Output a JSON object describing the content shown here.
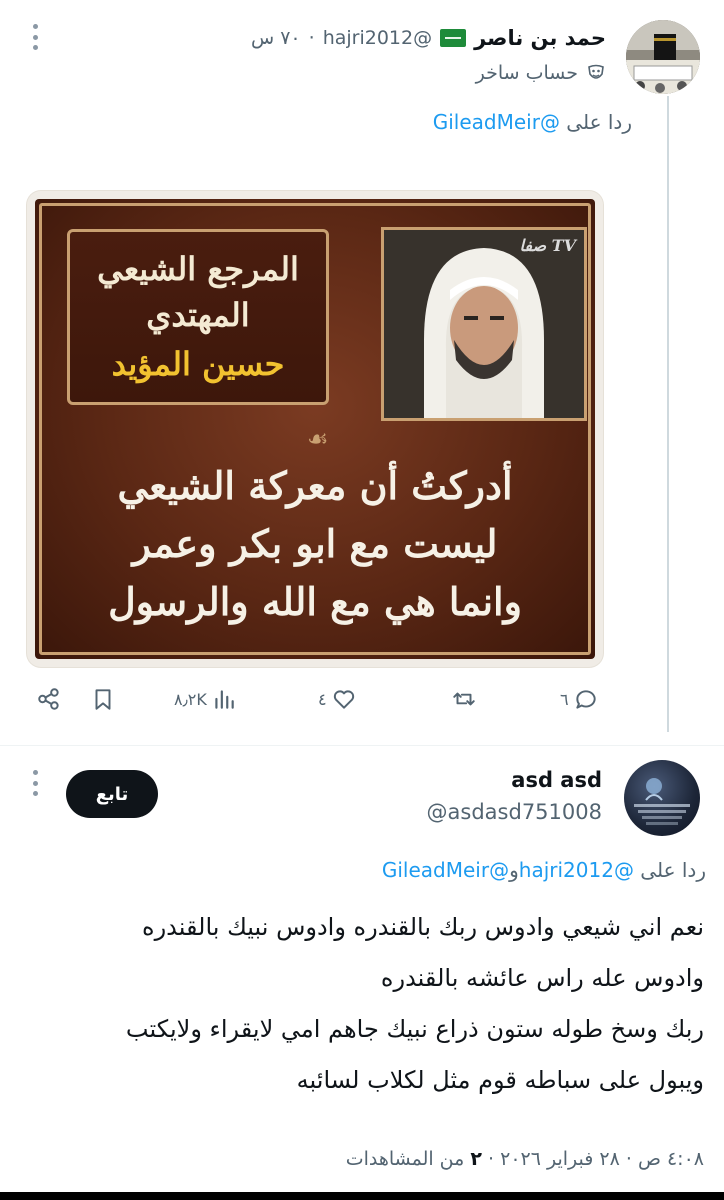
{
  "tweet1": {
    "display_name": "حمد بن ناصر",
    "handle": "@hajri2012",
    "time": "٧٠ س",
    "badge_label": "حساب ساخر",
    "replying_prefix": "ردا على",
    "replying_to": "@GileadMeir",
    "image": {
      "tv_logo": "صفا TV",
      "title_line1": "المرجع الشيعي",
      "title_line2": "المهتدي",
      "title_line3": "حسين المؤيد",
      "ornament": "☙",
      "quote_line1": "أدركتُ أن معركة الشيعي",
      "quote_line2": "ليست مع ابو بكر وعمر",
      "quote_line3": "وانما هي مع الله والرسول"
    },
    "actions": {
      "replies": "٦",
      "reposts": "",
      "likes": "٤",
      "views": "٨٫٢K"
    }
  },
  "tweet2": {
    "display_name": "asd asd",
    "handle": "@asdasd751008",
    "follow_label": "تابع",
    "replying_prefix": "ردا على",
    "replying_to_1": "@hajri2012",
    "replying_joiner": "و",
    "replying_to_2": "@GileadMeir",
    "lines": [
      "نعم اني شيعي وادوس ربك بالقندره وادوس نبيك بالقندره",
      "وادوس عله راس عائشه بالقندره",
      "ربك وسخ طوله ستون ذراع نبيك جاهم امي لايقراء ولايكتب",
      "ويبول على سباطه قوم مثل لكلاب لسائبه"
    ],
    "meta_time": "٤:٠٨ ص",
    "meta_sep": "·",
    "meta_date": "٢٨ فبراير ٢٠٢٦",
    "meta_views_count": "٢",
    "meta_views_label": "من المشاهدات"
  },
  "colors": {
    "text_primary": "#0f1419",
    "text_secondary": "#536471",
    "link": "#1d9bf0",
    "divider": "#eff3f4"
  },
  "icons": [
    "more-vertical-icon",
    "flag-icon",
    "parody-mask-icon",
    "reply-icon",
    "repost-icon",
    "like-icon",
    "views-icon",
    "bookmark-icon",
    "share-icon"
  ]
}
